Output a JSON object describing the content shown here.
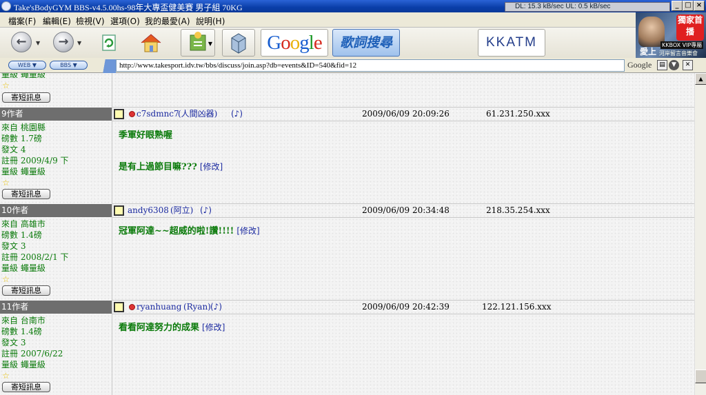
{
  "window": {
    "title": "Take'sBodyGYM BBS-v4.5.00hs-98年大專盃健美賽 男子組 70KG",
    "net_status": "DL: 15.3 kB/sec  UL: 0.5 kB/sec",
    "min": "_",
    "max": "□",
    "close": "×"
  },
  "menu": [
    "檔案(F)",
    "編輯(E)",
    "檢視(V)",
    "選項(O)",
    "我的最愛(A)",
    "說明(H)"
  ],
  "toolbar": {
    "google": "Google",
    "lyrics": "歌詞搜尋",
    "kkatm": "KKATM"
  },
  "banner": {
    "badge": "獨家首播",
    "vip": "KKBOX VIP專屬",
    "sub": "河岸留言音樂會",
    "love": "愛上"
  },
  "address": {
    "web_pill": "WEB",
    "bbs_pill": "BBS",
    "url": "http://www.takesport.idv.tw/bbs/discuss/join.asp?db=events&ID=540&fid=12",
    "google_label": "Google"
  },
  "top_fragment": {
    "level": "量級 蠅量級",
    "msg_button": "寄短訊息"
  },
  "posts": [
    {
      "author_num": "9作者",
      "from": "來自 桃園縣",
      "pounds": "磅數 1.7磅",
      "posts": "發文 4",
      "registered": "註冊 2009/4/9 下",
      "level": "量級 蠅量級",
      "msg_button": "寄短訊息",
      "username": "c7sdmnc7",
      "nickname": "(人間凶器)",
      "datetime": "2009/06/09 20:09:26",
      "ip": "61.231.250.xxx",
      "body1": "季軍好眼熟喔",
      "body2": "是有上過節目嘛???",
      "edit": "[修改]"
    },
    {
      "author_num": "10作者",
      "from": "來自 高雄市",
      "pounds": "磅數 1.4磅",
      "posts": "發文 3",
      "registered": "註冊 2008/2/1 下",
      "level": "量級 蠅量級",
      "msg_button": "寄短訊息",
      "username": "andy6308",
      "nickname": "(阿立)",
      "datetime": "2009/06/09 20:34:48",
      "ip": "218.35.254.xxx",
      "body1": "冠軍阿達~~超威的啦!讚!!!!",
      "edit": "[修改]"
    },
    {
      "author_num": "11作者",
      "from": "來自 台南市",
      "pounds": "磅數 1.4磅",
      "posts": "發文 3",
      "registered": "註冊 2007/6/22",
      "level": "量級 蠅量級",
      "msg_button": "寄短訊息",
      "username": "ryanhuang",
      "nickname": "(Ryan)",
      "datetime": "2009/06/09 20:42:39",
      "ip": "122.121.156.xxx",
      "body1": "看看阿達努力的成果",
      "edit": "[修改]"
    }
  ]
}
